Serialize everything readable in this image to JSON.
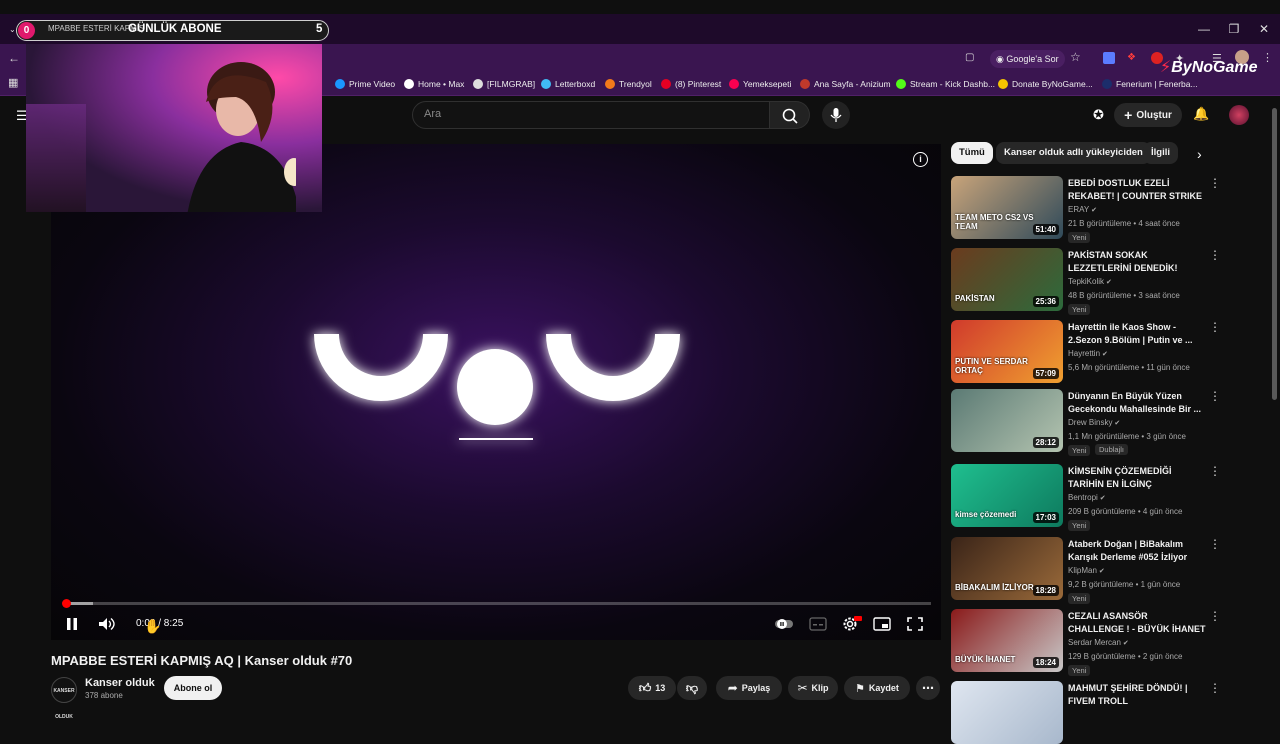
{
  "overlay": {
    "counter_value": "0",
    "subtitle": "MPABBE ESTERİ KAPMIŞ",
    "title": "GÜNLÜK ABONE",
    "count": "5",
    "brand": "ByNoGame"
  },
  "browser": {
    "google_lens_label": "Google'a Sor",
    "bookmarks": [
      {
        "label": "Prime Video",
        "color": "#1a98ff"
      },
      {
        "label": "Home • Max",
        "color": "#ffffff"
      },
      {
        "label": "[FILMGRAB]",
        "color": "#dddddd"
      },
      {
        "label": "Letterboxd",
        "color": "#40bcf4"
      },
      {
        "label": "Trendyol",
        "color": "#f27a1a"
      },
      {
        "label": "(8) Pinterest",
        "color": "#e60023"
      },
      {
        "label": "Yemeksepeti",
        "color": "#fa0050"
      },
      {
        "label": "Ana Sayfa - Anizium",
        "color": "#c0392b"
      },
      {
        "label": "Stream - Kick Dashb...",
        "color": "#53fc18"
      },
      {
        "label": "Donate ByNoGame...",
        "color": "#f5c400"
      },
      {
        "label": "Fenerium | Fenerba...",
        "color": "#1c2d6b"
      }
    ]
  },
  "header": {
    "search_placeholder": "Ara",
    "create_label": "Oluştur"
  },
  "player": {
    "current_time": "0:02",
    "duration": "8:25",
    "time_display": "0:02 / 8:25",
    "progress": 0.004
  },
  "video": {
    "title": "MPABBE ESTERİ KAPMIŞ AQ | Kanser olduk #70",
    "channel_name": "Kanser olduk",
    "channel_avatar_text": "KANSER OLDUK",
    "subscribers": "378 abone",
    "subscribe_label": "Abone ol",
    "likes": "13",
    "share_label": "Paylaş",
    "clip_label": "Klip",
    "save_label": "Kaydet"
  },
  "chips": [
    "Tümü",
    "Kanser olduk adlı yükleyiciden",
    "İlgili"
  ],
  "recommendations": [
    {
      "title": "EBEDİ DOSTLUK EZELİ REKABET! | COUNTER STRIKE ...",
      "channel": "ERAY",
      "meta": "21 B görüntüleme • 4 saat önce",
      "badge": "Yeni",
      "duration": "51:40",
      "thumb_text": "TEAM METO   CS2 VS   TEAM",
      "colors": [
        "#c9a47a",
        "#2f4a5a"
      ]
    },
    {
      "title": "PAKİSTAN SOKAK LEZZETLERİNİ DENEDİK!",
      "channel": "TepkiKolik",
      "meta": "48 B görüntüleme • 3 saat önce",
      "badge": "Yeni",
      "duration": "25:36",
      "thumb_text": "PAKİSTAN",
      "colors": [
        "#6b3b1e",
        "#2c6b3c"
      ]
    },
    {
      "title": "Hayrettin ile Kaos Show - 2.Sezon 9.Bölüm | Putin ve ...",
      "channel": "Hayrettin",
      "meta": "5,6 Mn görüntüleme • 11 gün önce",
      "badge": "",
      "duration": "57:09",
      "thumb_text": "PUTIN VE SERDAR ORTAÇ",
      "colors": [
        "#d03a2c",
        "#f0a030"
      ]
    },
    {
      "title": "Dünyanın En Büyük Yüzen Gecekondu Mahallesinde Bir ...",
      "channel": "Drew Binsky",
      "meta": "1,1 Mn görüntüleme • 3 gün önce",
      "badge": "Yeni",
      "badge2": "Dublajlı",
      "duration": "28:12",
      "thumb_text": "",
      "colors": [
        "#5b7a74",
        "#b4c4b0"
      ]
    },
    {
      "title": "KİMSENİN ÇÖZEMEDİĞİ TARİHİN EN İLGİNÇ KAYBOLM...",
      "channel": "Bentropi",
      "meta": "209 B görüntüleme • 4 gün önce",
      "badge": "Yeni",
      "duration": "17:03",
      "thumb_text": "kimse çözemedi",
      "colors": [
        "#1fbf8f",
        "#0e7a5e"
      ]
    },
    {
      "title": "Ataberk Doğan | BiBakalım Karışık Derleme #052 İzliyor",
      "channel": "KlipMan",
      "meta": "9,2 B görüntüleme • 1 gün önce",
      "badge": "Yeni",
      "duration": "18:28",
      "thumb_text": "BİBAKALIM İZLİYOR",
      "colors": [
        "#3a2418",
        "#9a6a3a"
      ]
    },
    {
      "title": "CEZALI ASANSÖR CHALLENGE ! - BÜYÜK İHANET",
      "channel": "Serdar Mercan",
      "meta": "129 B görüntüleme • 2 gün önce",
      "badge": "Yeni",
      "duration": "18:24",
      "thumb_text": "BÜYÜK İHANET",
      "colors": [
        "#8a1a1a",
        "#c8c8c8"
      ]
    },
    {
      "title": "MAHMUT ŞEHİRE DÖNDÜ! | FIVEM TROLL",
      "channel": "",
      "meta": "",
      "badge": "",
      "duration": "",
      "thumb_text": "",
      "colors": [
        "#dfe6f0",
        "#a8b8cc"
      ]
    }
  ]
}
